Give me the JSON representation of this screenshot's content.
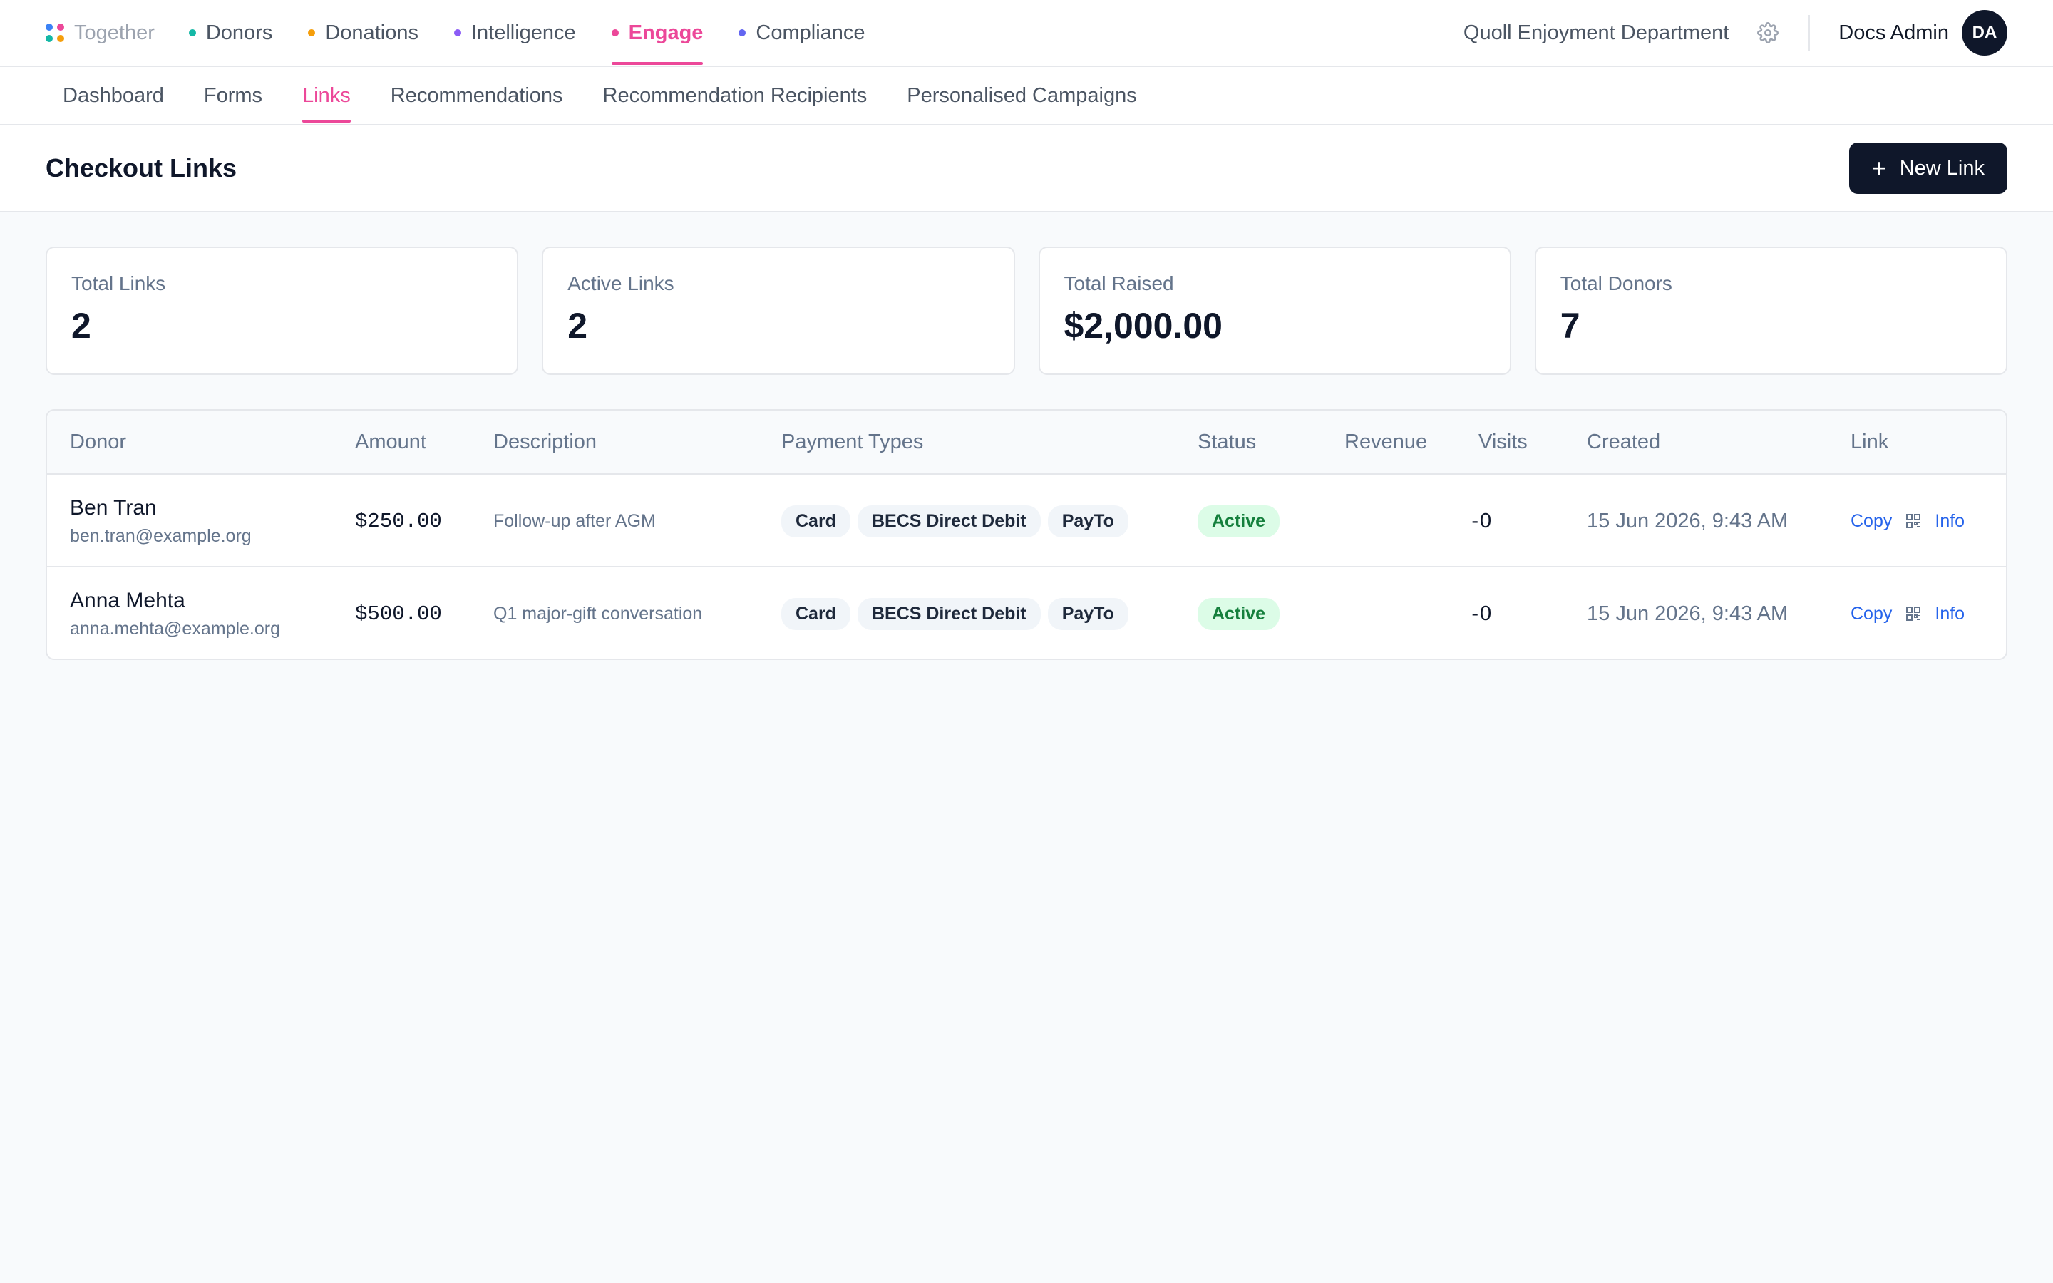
{
  "brand": {
    "name": "Together",
    "dot_colors": [
      "#3b82f6",
      "#ec4899",
      "#14b8a6",
      "#f59e0b"
    ]
  },
  "nav": [
    {
      "label": "Donors",
      "color": "#14b8a6",
      "active": false
    },
    {
      "label": "Donations",
      "color": "#f59e0b",
      "active": false
    },
    {
      "label": "Intelligence",
      "color": "#8b5cf6",
      "active": false
    },
    {
      "label": "Engage",
      "color": "#ec4899",
      "active": true
    },
    {
      "label": "Compliance",
      "color": "#6366f1",
      "active": false
    }
  ],
  "header": {
    "org_name": "Quoll Enjoyment Department",
    "user_name": "Docs Admin",
    "user_initials": "DA"
  },
  "subnav": [
    {
      "label": "Dashboard",
      "active": false
    },
    {
      "label": "Forms",
      "active": false
    },
    {
      "label": "Links",
      "active": true
    },
    {
      "label": "Recommendations",
      "active": false
    },
    {
      "label": "Recommendation Recipients",
      "active": false
    },
    {
      "label": "Personalised Campaigns",
      "active": false
    }
  ],
  "page": {
    "title": "Checkout Links",
    "new_button_label": "New Link"
  },
  "stats": [
    {
      "label": "Total Links",
      "value": "2"
    },
    {
      "label": "Active Links",
      "value": "2"
    },
    {
      "label": "Total Raised",
      "value": "$2,000.00"
    },
    {
      "label": "Total Donors",
      "value": "7"
    }
  ],
  "table": {
    "columns": [
      "Donor",
      "Amount",
      "Description",
      "Payment Types",
      "Status",
      "Revenue",
      "Visits",
      "Created",
      "Link"
    ],
    "rows": [
      {
        "donor_name": "Ben Tran",
        "donor_email": "ben.tran@example.org",
        "amount": "$250.00",
        "description": "Follow-up after AGM",
        "payment_types": [
          "Card",
          "BECS Direct Debit",
          "PayTo"
        ],
        "status": "Active",
        "revenue": "-",
        "visits": "0",
        "created": "15 Jun 2026, 9:43 AM",
        "copy_label": "Copy",
        "info_label": "Info"
      },
      {
        "donor_name": "Anna Mehta",
        "donor_email": "anna.mehta@example.org",
        "amount": "$500.00",
        "description": "Q1 major-gift conversation",
        "payment_types": [
          "Card",
          "BECS Direct Debit",
          "PayTo"
        ],
        "status": "Active",
        "revenue": "-",
        "visits": "0",
        "created": "15 Jun 2026, 9:43 AM",
        "copy_label": "Copy",
        "info_label": "Info"
      }
    ]
  },
  "colors": {
    "accent": "#ec4899",
    "primary_button": "#0f172a",
    "status_active_bg": "#dcfce7",
    "status_active_text": "#15803d",
    "link": "#2563eb"
  },
  "icons": {
    "settings": "gear-icon",
    "new_link": "plus-icon",
    "qr": "qr-code-icon"
  }
}
